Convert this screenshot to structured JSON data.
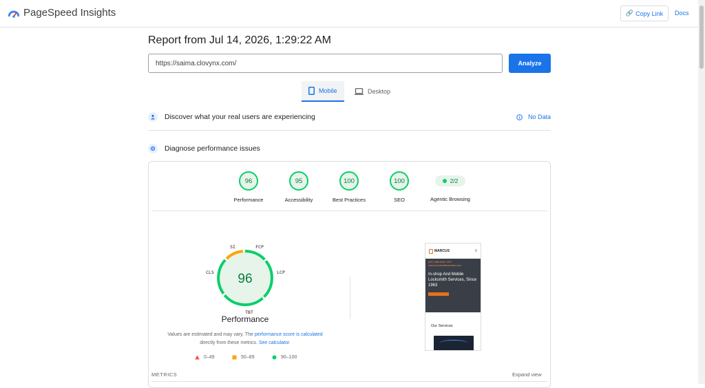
{
  "app": {
    "name": "PageSpeed Insights",
    "copy_link_label": "Copy Link",
    "docs_label": "Docs"
  },
  "report": {
    "title": "Report from Jul 14, 2026, 1:29:22 AM",
    "url_value": "https://saima.clovynx.com/",
    "analyze_label": "Analyze"
  },
  "tabs": [
    {
      "label": "Mobile",
      "selected": true
    },
    {
      "label": "Desktop",
      "selected": false
    }
  ],
  "sections": {
    "real_users": {
      "title": "Discover what your real users are experiencing",
      "status": "No Data"
    },
    "diagnose": {
      "title": "Diagnose performance issues"
    }
  },
  "scores": [
    {
      "label": "Performance",
      "value": "96"
    },
    {
      "label": "Accessibility",
      "value": "95"
    },
    {
      "label": "Best Practices",
      "value": "100"
    },
    {
      "label": "SEO",
      "value": "100"
    },
    {
      "label": "Agentic Browsing",
      "value": "2/2"
    }
  ],
  "performance": {
    "score": "96",
    "label": "Performance",
    "metric_labels": {
      "si": "SI",
      "fcp": "FCP",
      "lcp": "LCP",
      "tbt": "TBT",
      "cls": "CLS"
    },
    "note_prefix": "Values are estimated and may vary. The ",
    "note_link1": "performance score is calculated",
    "note_middle": "directly from these metrics. ",
    "note_link2": "See calculator."
  },
  "legend": [
    {
      "range": "0–49",
      "color": "#ff4e42"
    },
    {
      "range": "50–89",
      "color": "#ffa400"
    },
    {
      "range": "90–100",
      "color": "#0cce6b"
    }
  ],
  "metrics": {
    "heading": "METRICS",
    "expand_label": "Expand view"
  },
  "preview": {
    "brand": "MARCUS",
    "hero_small": "(407) 488-4448 / 24/7\nmarcus-locksmithservices.com",
    "hero_title": "In-shop And Mobile Locksmith Services, Since 1963",
    "services": "Our Services"
  },
  "colors": {
    "accent": "#1a73e8",
    "good": "#0cce6b",
    "good_text": "#0c7b3e",
    "average": "#ffa400"
  }
}
